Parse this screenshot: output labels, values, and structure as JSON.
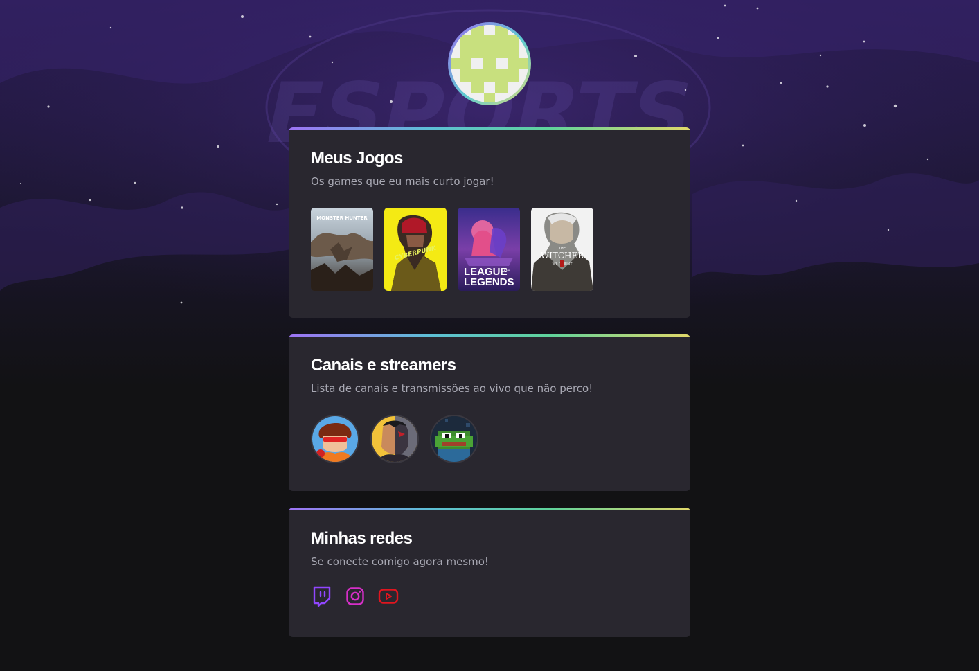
{
  "profile": {
    "avatar_alt": "avatar"
  },
  "colors": {
    "accent_gradient": [
      "#9e73f5",
      "#5dbfd6",
      "#5fd39b",
      "#e2d96a"
    ],
    "card_bg": "#29272f",
    "page_bg": "#121214",
    "twitch": "#9146ff",
    "instagram": "#d62fc8",
    "youtube": "#e0151f"
  },
  "games_section": {
    "title": "Meus Jogos",
    "subtitle": "Os games que eu mais curto jogar!",
    "games": [
      {
        "name": "Monster Hunter World",
        "cover_text": "MONSTER HUNTER"
      },
      {
        "name": "Cyberpunk 2077",
        "cover_text": "CYBERPUNK"
      },
      {
        "name": "League of Legends",
        "cover_text_1": "LEAGUE",
        "cover_text_of": "OF",
        "cover_text_2": "LEGENDS"
      },
      {
        "name": "The Witcher 3 Wild Hunt",
        "cover_text_1": "THE",
        "cover_text_2": "WITCHER",
        "cover_text_3": "WILD HUNT"
      }
    ]
  },
  "streamers_section": {
    "title": "Canais e streamers",
    "subtitle": "Lista de canais e transmissões ao vivo que não perco!",
    "streamers": [
      {
        "name": "streamer-1"
      },
      {
        "name": "streamer-2"
      },
      {
        "name": "streamer-3"
      }
    ]
  },
  "social_section": {
    "title": "Minhas redes",
    "subtitle": "Se conecte comigo agora mesmo!",
    "links": [
      {
        "network": "twitch",
        "icon": "twitch-icon"
      },
      {
        "network": "instagram",
        "icon": "instagram-icon"
      },
      {
        "network": "youtube",
        "icon": "youtube-icon"
      }
    ]
  }
}
